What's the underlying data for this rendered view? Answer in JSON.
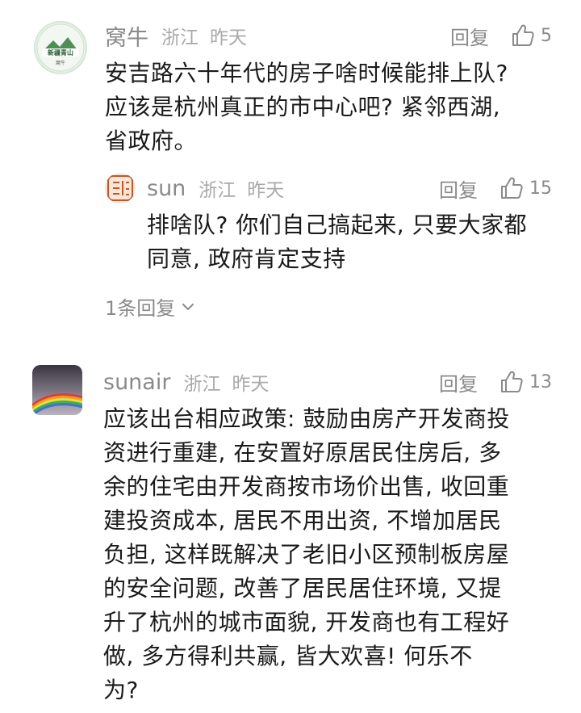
{
  "comments": [
    {
      "user": "窝牛",
      "location": "浙江",
      "time": "昨天",
      "reply_label": "回复",
      "likes": "5",
      "avatar_text": "新疆青山",
      "avatar_caption": "窝牛",
      "lines": [
        "安吉路六十年代的房子啥时候能排上队?",
        "应该是杭州真正的市中心吧? 紧邻西湖,",
        "省政府。"
      ],
      "reply": {
        "user": "sun",
        "location": "浙江",
        "time": "昨天",
        "reply_label": "回复",
        "likes": "15",
        "lines": [
          "排啥队? 你们自己搞起来, 只要大家都",
          "同意, 政府肯定支持"
        ]
      },
      "replies_count_label": "1条回复"
    },
    {
      "user": "sunair",
      "location": "浙江",
      "time": "昨天",
      "reply_label": "回复",
      "likes": "13",
      "lines": [
        "应该出台相应政策: 鼓励由房产开发商投",
        "资进行重建, 在安置好原居民住房后, 多",
        "余的住宅由开发商按市场价出售, 收回重",
        "建投资成本, 居民不用出资, 不增加居民",
        "负担, 这样既解决了老旧小区预制板房屋",
        "的安全问题, 改善了居民居住环境, 又提",
        "升了杭州的城市面貌, 开发商也有工程好",
        "做, 多方得利共赢, 皆大欢喜! 何乐不",
        "为?"
      ]
    }
  ]
}
